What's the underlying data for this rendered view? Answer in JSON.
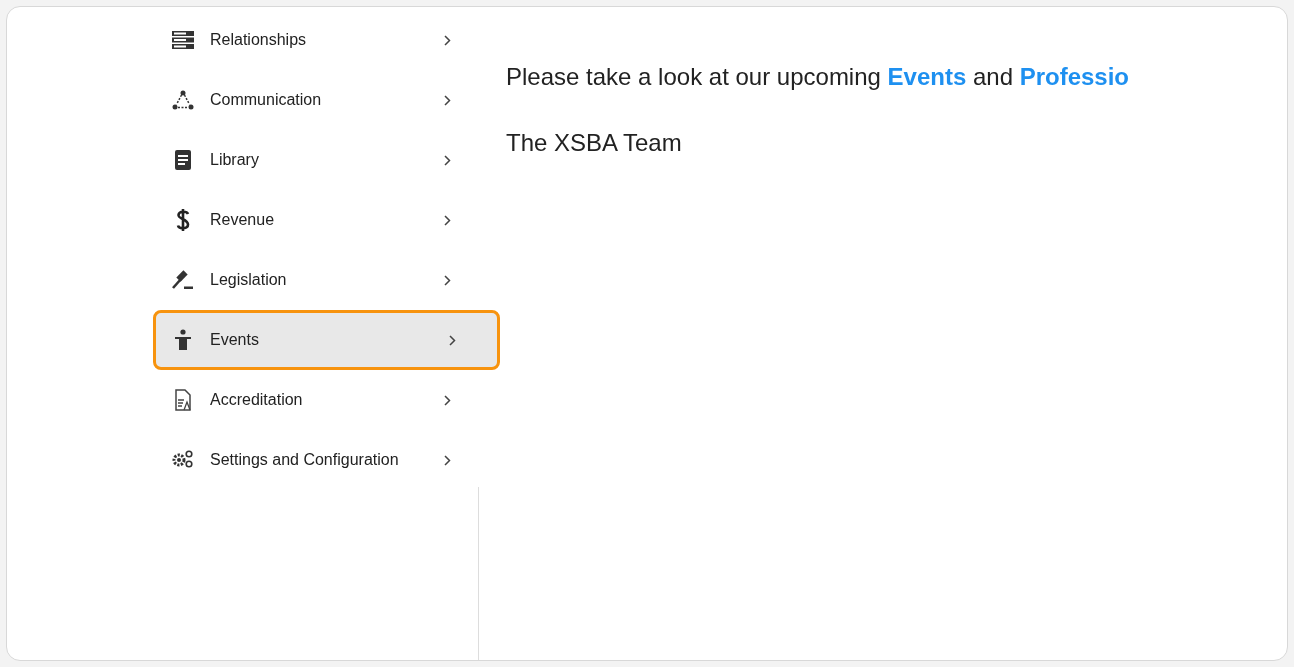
{
  "sidebar": {
    "items": [
      {
        "label": "Relationships",
        "selected": false
      },
      {
        "label": "Communication",
        "selected": false
      },
      {
        "label": "Library",
        "selected": false
      },
      {
        "label": "Revenue",
        "selected": false
      },
      {
        "label": "Legislation",
        "selected": false
      },
      {
        "label": "Events",
        "selected": true
      },
      {
        "label": "Accreditation",
        "selected": false
      },
      {
        "label": "Settings and Configuration",
        "selected": false
      }
    ]
  },
  "message": {
    "parts": [
      {
        "kind": "text",
        "text": "Please take a look at our upcoming "
      },
      {
        "kind": "link",
        "text": "Events"
      },
      {
        "kind": "text",
        "text": " and "
      },
      {
        "kind": "link",
        "text": "Professio"
      }
    ],
    "signature": "The XSBA Team"
  }
}
